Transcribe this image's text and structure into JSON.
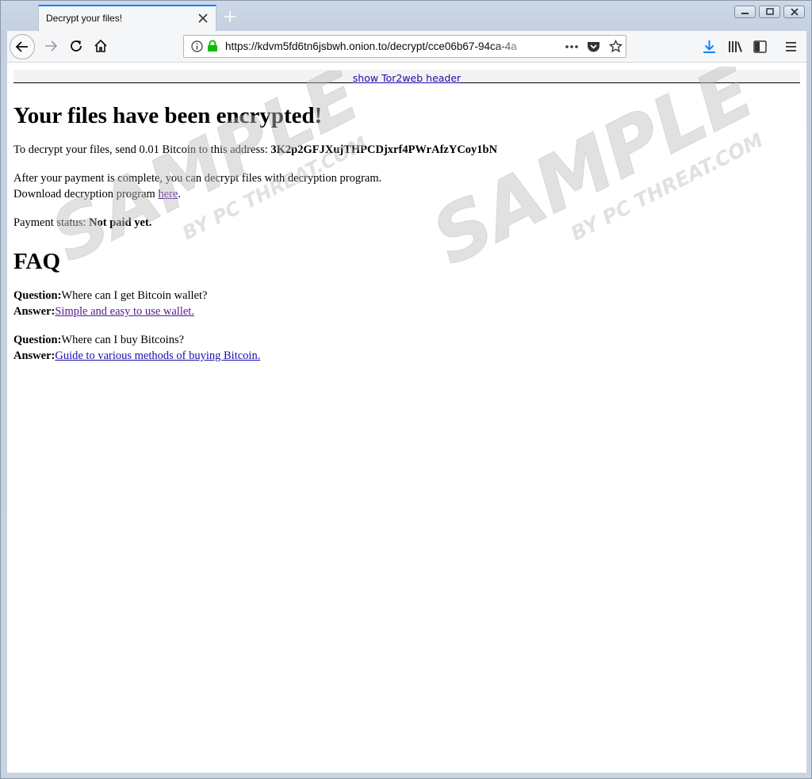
{
  "browser": {
    "tab_title": "Decrypt your files!",
    "url": "https://kdvm5fd6tn6jsbwh.onion.to/decrypt/cce06b67-94ca-4a"
  },
  "tor2web": {
    "header_link": "show Tor2web header"
  },
  "content": {
    "heading": "Your files have been encrypted!",
    "send_text": "To decrypt your files, send 0.01 Bitcoin to this address: ",
    "address": "3K2p2GFJXujTHPCDjxrf4PWrAfzYCoy1bN",
    "after_line": "After your payment is complete, you can decrypt files with decryption program.",
    "download_text": "Download decryption program ",
    "download_link": "here",
    "download_end": ".",
    "status_label": "Payment status: ",
    "status_value": "Not paid yet.",
    "faq_heading": "FAQ",
    "faq": [
      {
        "q_label": "Question:",
        "question": "Where can I get Bitcoin wallet?",
        "a_label": "Answer:",
        "answer": "Simple and easy to use wallet."
      },
      {
        "q_label": "Question:",
        "question": "Where can I buy Bitcoins?",
        "a_label": "Answer:",
        "answer": "Guide to various methods of buying Bitcoin."
      }
    ]
  },
  "watermark": {
    "big": "SAMPLE",
    "small": "BY PC THREAT.COM"
  },
  "colors": {
    "accent": "#0a84ff",
    "link": "#1a0dab",
    "visited": "#551a8b",
    "lock": "#12bc00"
  }
}
